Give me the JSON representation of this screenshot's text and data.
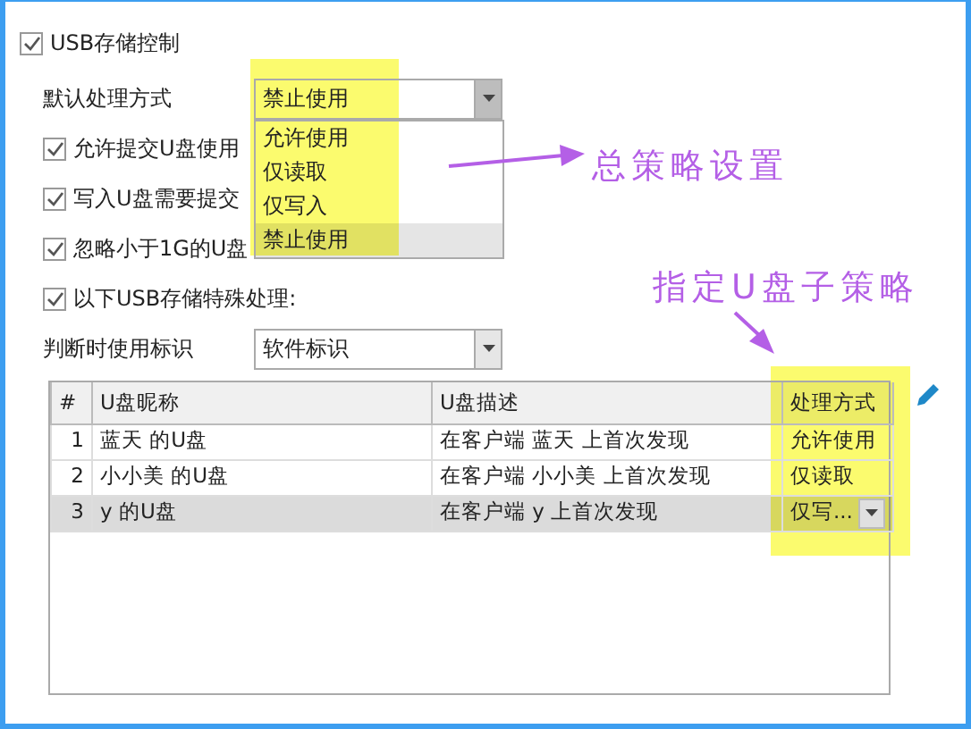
{
  "usb_control": {
    "label": "USB存储控制",
    "checked": true
  },
  "default_action": {
    "label": "默认处理方式",
    "value": "禁止使用",
    "expanded": true,
    "options": [
      {
        "label": "允许使用",
        "selected": false
      },
      {
        "label": "仅读取",
        "selected": false
      },
      {
        "label": "仅写入",
        "selected": false
      },
      {
        "label": "禁止使用",
        "selected": true
      }
    ]
  },
  "options": [
    {
      "label": "允许提交U盘使用",
      "checked": true
    },
    {
      "label": "写入U盘需要提交",
      "checked": true
    },
    {
      "label": "忽略小于1G的U盘",
      "checked": true
    },
    {
      "label": "以下USB存储特殊处理:",
      "checked": true
    }
  ],
  "identifier": {
    "label": "判断时使用标识",
    "value": "软件标识"
  },
  "table": {
    "columns": [
      "#",
      "U盘昵称",
      "U盘描述",
      "处理方式"
    ],
    "rows": [
      {
        "cells": [
          "1",
          "蓝天 的U盘",
          "在客户端 蓝天 上首次发现",
          "允许使用"
        ],
        "selected": false,
        "editing": false
      },
      {
        "cells": [
          "2",
          "小小美 的U盘",
          "在客户端 小小美 上首次发现",
          "仅读取"
        ],
        "selected": false,
        "editing": false
      },
      {
        "cells": [
          "3",
          "y 的U盘",
          "在客户端 y 上首次发现",
          "仅写..."
        ],
        "selected": true,
        "editing": true
      }
    ]
  },
  "annotations": [
    {
      "text": "总策略设置"
    },
    {
      "text": "指定U盘子策略"
    }
  ]
}
